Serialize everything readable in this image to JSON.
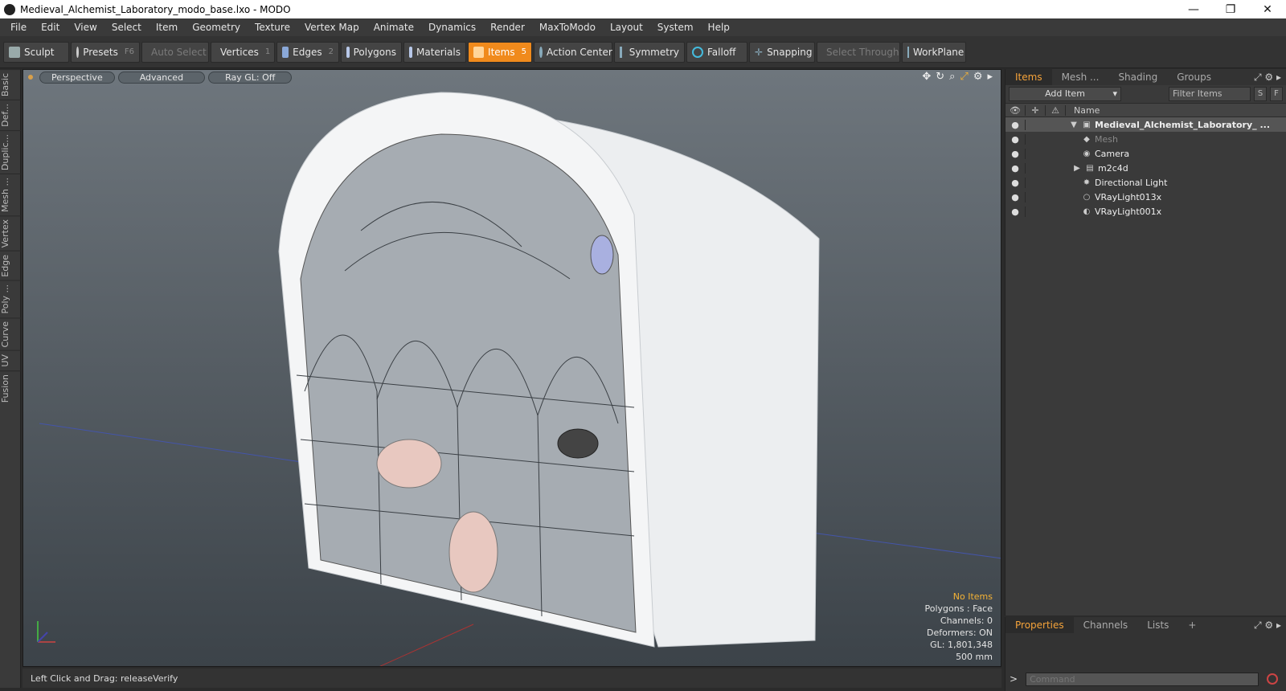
{
  "window": {
    "title": "Medieval_Alchemist_Laboratory_modo_base.lxo - MODO",
    "minimize": "—",
    "restore": "❐",
    "close": "✕"
  },
  "menu": [
    "File",
    "Edit",
    "View",
    "Select",
    "Item",
    "Geometry",
    "Texture",
    "Vertex Map",
    "Animate",
    "Dynamics",
    "Render",
    "MaxToModo",
    "Layout",
    "System",
    "Help"
  ],
  "toolbar": {
    "sculpt": "Sculpt",
    "presets": "Presets",
    "presets_key": "F6",
    "auto_select": "Auto Select",
    "vertices": "Vertices",
    "vertices_key": "1",
    "edges": "Edges",
    "edges_key": "2",
    "polygons": "Polygons",
    "materials": "Materials",
    "items": "Items",
    "items_key": "5",
    "action_center": "Action Center",
    "symmetry": "Symmetry",
    "falloff": "Falloff",
    "snapping": "Snapping",
    "select_through": "Select Through",
    "workplane": "WorkPlane"
  },
  "left_tabs": [
    "Basic",
    "Def...",
    "Duplic...",
    "Mesh ...",
    "Vertex",
    "Edge",
    "Poly ...",
    "Curve",
    "UV",
    "Fusion"
  ],
  "viewport": {
    "perspective": "Perspective",
    "advanced": "Advanced",
    "raygl": "Ray GL: Off"
  },
  "hud": {
    "no_items": "No Items",
    "polygons": "Polygons : Face",
    "channels": "Channels: 0",
    "deformers": "Deformers: ON",
    "gl": "GL: 1,801,348",
    "scale": "500 mm"
  },
  "status": {
    "text": "Left Click and Drag:   releaseVerify"
  },
  "right_panel": {
    "tabs": [
      "Items",
      "Mesh ...",
      "Shading",
      "Groups"
    ],
    "add_item": "Add Item",
    "filter": "Filter Items",
    "s": "S",
    "f": "F",
    "name_col": "Name",
    "items": [
      {
        "name": "Medieval_Alchemist_Laboratory_ ...",
        "expander": "▼",
        "icon": "scene-icon"
      },
      {
        "name": "Mesh",
        "expander": "",
        "icon": "mesh-icon"
      },
      {
        "name": "Camera",
        "expander": "",
        "icon": "camera-icon"
      },
      {
        "name": "m2c4d",
        "expander": "▶",
        "icon": "group-icon"
      },
      {
        "name": "Directional Light",
        "expander": "",
        "icon": "light-icon"
      },
      {
        "name": "VRayLight013x",
        "expander": "",
        "icon": "light-icon"
      },
      {
        "name": "VRayLight001x",
        "expander": "",
        "icon": "light-icon"
      }
    ]
  },
  "bottom_panel": {
    "tabs": [
      "Properties",
      "Channels",
      "Lists"
    ],
    "add": "+",
    "command_placeholder": "Command",
    "prompt": ">"
  }
}
